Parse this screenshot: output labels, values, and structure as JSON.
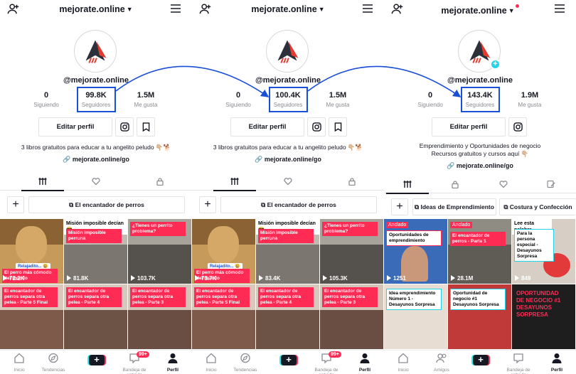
{
  "accent_colors": {
    "tiktok_red": "#fe2c55",
    "tiktok_cyan": "#25f4ee",
    "highlight_blue": "#1a4fd8"
  },
  "panels": [
    {
      "username": "mejorate.online",
      "handle": "@mejorate.online",
      "stats": [
        {
          "value": "0",
          "label": "Siguiendo"
        },
        {
          "value": "99.8K",
          "label": "Seguidores"
        },
        {
          "value": "1.5M",
          "label": "Me gusta"
        }
      ],
      "edit_profile": "Editar perfil",
      "bio": "3 libros gratuitos para educar a tu angelito peludo 👇🏼🐕",
      "link": "mejorate.online/go",
      "playlist_label": "El encantador de perros",
      "tiles": [
        {
          "caption": "El perro más cómodo del mundo",
          "tag": "Relajadito... 😃",
          "views": "72.2K"
        },
        {
          "header": "Misión imposible decían 😎",
          "caption": "Misión imposible perruna",
          "views": "81.8K"
        },
        {
          "caption": "¿Tienes un perrito problema?",
          "views": "103.7K"
        },
        {
          "caption": "El encantador de perros separa otra pelea - Parte 5 Final"
        },
        {
          "caption": "El encantador de perros separa otra pelea - Parte 4"
        },
        {
          "caption": "El encantador de perros separa otra pelea - Parte 3"
        }
      ],
      "nav": {
        "home": "Inicio",
        "discover": "Tendencias",
        "inbox": "Bandeja de entrada",
        "inbox_badge": "99+",
        "profile": "Perfil"
      }
    },
    {
      "username": "mejorate.online",
      "handle": "@mejorate.online",
      "stats": [
        {
          "value": "0",
          "label": "Siguiendo"
        },
        {
          "value": "100.4K",
          "label": "Seguidores"
        },
        {
          "value": "1.5M",
          "label": "Me gusta"
        }
      ],
      "edit_profile": "Editar perfil",
      "bio": "3 libros gratuitos para educar a tu angelito peludo 👇🏼🐕",
      "link": "mejorate.online/go",
      "playlist_label": "El encantador de perros",
      "tiles": [
        {
          "caption": "El perro más cómodo del mundo",
          "tag": "Relajadito... 😃",
          "views": "73.7K"
        },
        {
          "header": "Misión imposible decían 😎",
          "caption": "Misión imposible perruna",
          "views": "83.4K"
        },
        {
          "caption": "¿Tienes un perrito problema?",
          "views": "105.3K"
        },
        {
          "caption": "El encantador de perros separa otra pelea - Parte 5 Final"
        },
        {
          "caption": "El encantador de perros separa otra pelea - Parte 4"
        },
        {
          "caption": "El encantador de perros separa otra pelea - Parte 3"
        }
      ],
      "nav": {
        "home": "Inicio",
        "discover": "Tendencias",
        "inbox": "Bandeja de entrada",
        "inbox_badge": "99+",
        "profile": "Perfil"
      }
    },
    {
      "username": "mejorate.online",
      "handle": "@mejorate.online",
      "stats": [
        {
          "value": "0",
          "label": "Siguiendo"
        },
        {
          "value": "143.4K",
          "label": "Seguidores"
        },
        {
          "value": "1.9M",
          "label": "Me gusta"
        }
      ],
      "edit_profile": "Editar perfil",
      "bio_line1": "Emprendimiento y Oportunidades de negocio",
      "bio_line2": "Recursos gratuitos y cursos aquí 👇🏼",
      "link": "mejorate.online/go",
      "playlist_label_1": "Ideas de Emprendimiento",
      "playlist_label_2": "Costura y Confección",
      "tiles": [
        {
          "pinned": "Anclado",
          "caption": "Oportunidades de emprendimiento",
          "views": "1251"
        },
        {
          "pinned": "Anclado",
          "caption": "El encantador de perros - Parte 1",
          "views": "28.1M"
        },
        {
          "header": "Lee esta palabra",
          "caption": "Para la persona especial - Desayunos Sorpresa",
          "views": "849"
        },
        {
          "caption": "Idea emprendimiento Número 1 - Desayunos Sorpresa"
        },
        {
          "caption": "Oportunidad de negocio #1 Desayunos Sorpresa"
        },
        {
          "caption": "OPORTUNIDAD DE NEGOCIO #1 DESAYUNOS SORPRESA"
        }
      ],
      "nav": {
        "home": "Inicio",
        "friends": "Amigos",
        "inbox": "Bandeja de entrada",
        "profile": "Perfil"
      }
    }
  ]
}
